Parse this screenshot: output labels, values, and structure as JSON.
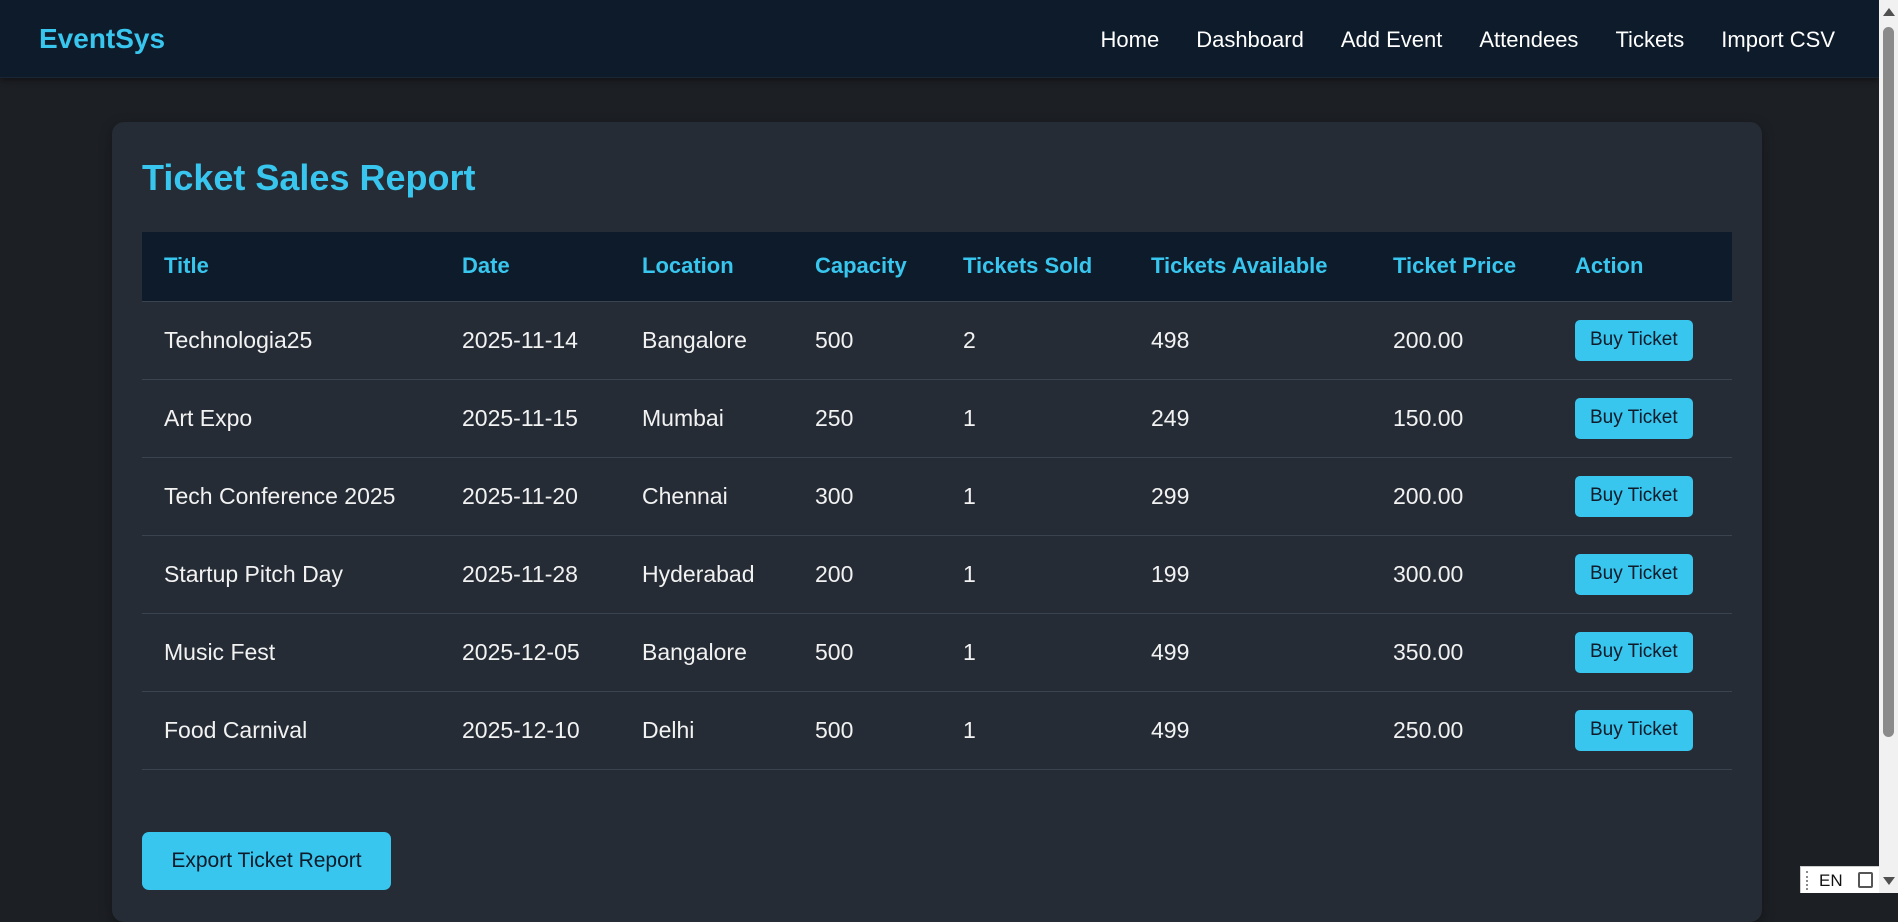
{
  "nav": {
    "brand": "EventSys",
    "links": [
      "Home",
      "Dashboard",
      "Add Event",
      "Attendees",
      "Tickets",
      "Import CSV"
    ]
  },
  "report": {
    "title": "Ticket Sales Report",
    "columns": [
      "Title",
      "Date",
      "Location",
      "Capacity",
      "Tickets Sold",
      "Tickets Available",
      "Ticket Price",
      "Action"
    ],
    "rows": [
      {
        "title": "Technologia25",
        "date": "2025-11-14",
        "location": "Bangalore",
        "capacity": "500",
        "sold": "2",
        "available": "498",
        "price": "200.00",
        "action": "Buy Ticket"
      },
      {
        "title": "Art Expo",
        "date": "2025-11-15",
        "location": "Mumbai",
        "capacity": "250",
        "sold": "1",
        "available": "249",
        "price": "150.00",
        "action": "Buy Ticket"
      },
      {
        "title": "Tech Conference 2025",
        "date": "2025-11-20",
        "location": "Chennai",
        "capacity": "300",
        "sold": "1",
        "available": "299",
        "price": "200.00",
        "action": "Buy Ticket"
      },
      {
        "title": "Startup Pitch Day",
        "date": "2025-11-28",
        "location": "Hyderabad",
        "capacity": "200",
        "sold": "1",
        "available": "199",
        "price": "300.00",
        "action": "Buy Ticket"
      },
      {
        "title": "Music Fest",
        "date": "2025-12-05",
        "location": "Bangalore",
        "capacity": "500",
        "sold": "1",
        "available": "499",
        "price": "350.00",
        "action": "Buy Ticket"
      },
      {
        "title": "Food Carnival",
        "date": "2025-12-10",
        "location": "Delhi",
        "capacity": "500",
        "sold": "1",
        "available": "499",
        "price": "250.00",
        "action": "Buy Ticket"
      }
    ],
    "export_label": "Export Ticket Report"
  },
  "taskbar": {
    "language": "EN"
  },
  "colors": {
    "accent": "#38c6ee",
    "navbar_bg": "#0d1b2a",
    "page_bg": "#1c1f24",
    "card_bg": "#252c35"
  }
}
